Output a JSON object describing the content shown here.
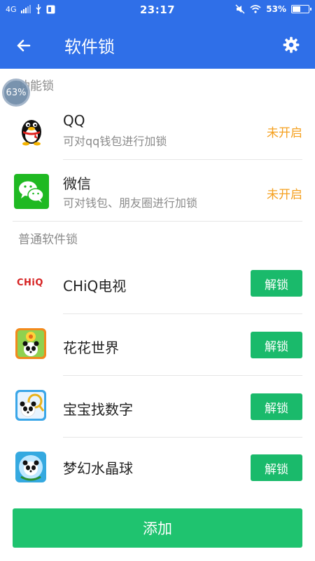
{
  "status_bar": {
    "network": "4G",
    "time": "23:17",
    "battery": "53%",
    "battery_level": 0.53
  },
  "app_bar": {
    "title": "软件锁"
  },
  "sections": {
    "function_lock": "功能锁",
    "normal_lock": "普通软件锁"
  },
  "function_apps": [
    {
      "name": "QQ",
      "desc": "可对qq钱包进行加锁",
      "status": "未开启",
      "icon": "qq-penguin-icon"
    },
    {
      "name": "微信",
      "desc": "可对钱包、朋友圈进行加锁",
      "status": "未开启",
      "icon": "wechat-icon"
    }
  ],
  "normal_apps": [
    {
      "name": "CHiQ电视",
      "button": "解锁",
      "logo_text": "CHiQ",
      "icon": "chiq-logo-icon"
    },
    {
      "name": "花花世界",
      "button": "解锁",
      "icon": "panda-flower-icon"
    },
    {
      "name": "宝宝找数字",
      "button": "解锁",
      "icon": "panda-numbers-icon"
    },
    {
      "name": "梦幻水晶球",
      "button": "解锁",
      "icon": "panda-crystal-icon"
    }
  ],
  "add_button": "添加",
  "floating_ball": "63%",
  "colors": {
    "primary": "#2f6fe8",
    "status_off": "#f5a01f",
    "unlock_button": "#1aba6b",
    "add_button": "#1fc36f"
  }
}
